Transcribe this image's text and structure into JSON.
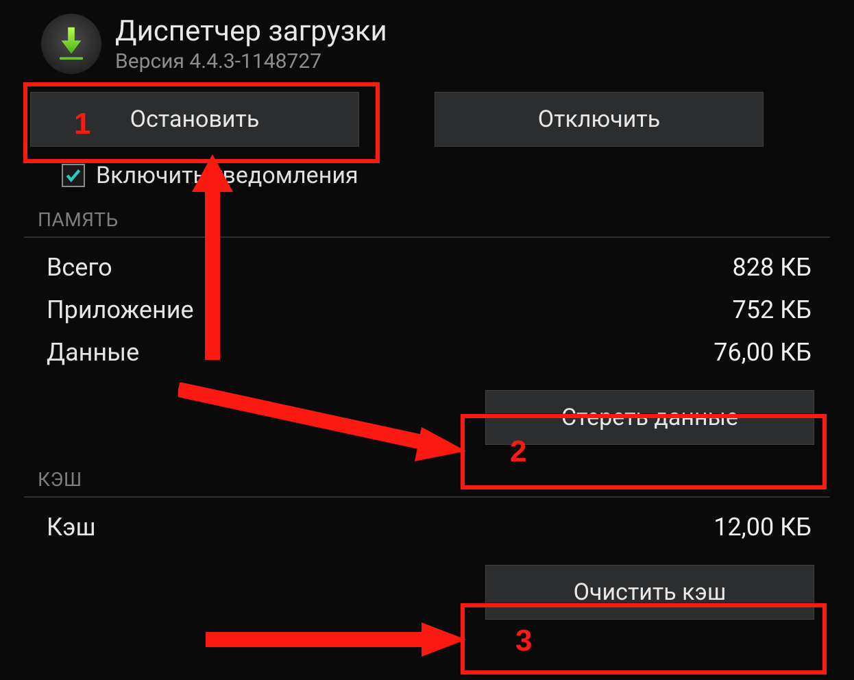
{
  "header": {
    "title": "Диспетчер загрузки",
    "version": "Версия 4.4.3-1148727"
  },
  "buttons": {
    "stop": "Остановить",
    "disable": "Отключить",
    "clear_data": "Стереть данные",
    "clear_cache": "Очистить кэш"
  },
  "notifications": {
    "label": "Включить уведомления",
    "checked": true
  },
  "sections": {
    "memory_title": "ПАМЯТЬ",
    "cache_title": "КЭШ"
  },
  "memory": {
    "total_label": "Всего",
    "total_value": "828 КБ",
    "app_label": "Приложение",
    "app_value": "752 КБ",
    "data_label": "Данные",
    "data_value": "76,00 КБ"
  },
  "cache": {
    "cache_label": "Кэш",
    "cache_value": "12,00 КБ"
  },
  "annotations": {
    "n1": "1",
    "n2": "2",
    "n3": "3"
  }
}
